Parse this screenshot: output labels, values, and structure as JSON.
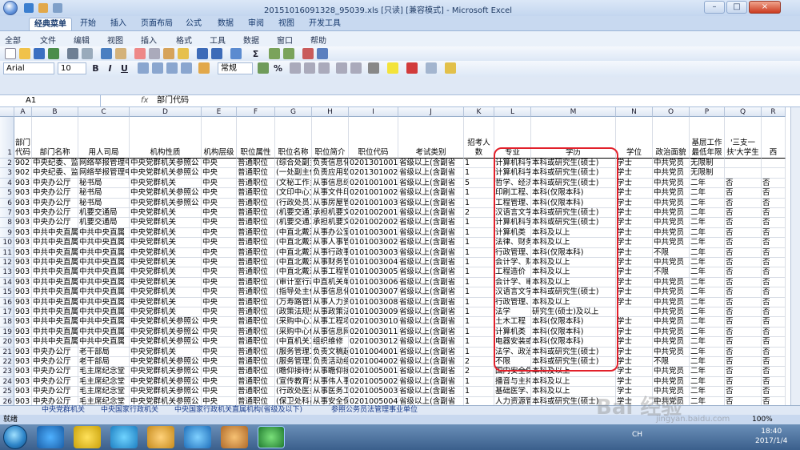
{
  "window": {
    "title": "20151016091328_95039.xls  [只读]  [兼容模式] - Microsoft Excel",
    "controls": [
      "–",
      "□",
      "×"
    ]
  },
  "ribbon_tabs": [
    "经典菜单",
    "开始",
    "插入",
    "页面布局",
    "公式",
    "数据",
    "审阅",
    "视图",
    "开发工具"
  ],
  "menus": [
    "全部",
    "文件",
    "编辑",
    "视图",
    "插入",
    "格式",
    "工具",
    "数据",
    "窗口",
    "帮助"
  ],
  "toolbar": {
    "font_name": "Arial",
    "font_size": "10",
    "number_format": "常规",
    "bold": "B",
    "italic": "I",
    "underline": "U",
    "sum": "Σ",
    "percent": "%"
  },
  "formula_bar": {
    "name_box": "A1",
    "fx": "fx",
    "value": "部门代码"
  },
  "columns": [
    "A",
    "B",
    "C",
    "D",
    "E",
    "F",
    "G",
    "H",
    "I",
    "J",
    "K",
    "L",
    "M",
    "N",
    "O",
    "P",
    "Q",
    "R"
  ],
  "header_row": {
    "row": "1",
    "cells": [
      "部门代码",
      "部门名称",
      "用人司局",
      "机构性质",
      "机构层级",
      "职位属性",
      "职位名称",
      "职位简介",
      "职位代码",
      "考试类别",
      "招考人数",
      "专业",
      "学历",
      "学位",
      "政治面貌",
      "基层工作最低年限",
      "'三支一扶'大学生",
      "西"
    ]
  },
  "rows": [
    {
      "n": "2",
      "c": [
        "902",
        "中央纪委、监",
        "网络举报管理中",
        "中央党群机关参照公",
        "中央",
        "普通职位",
        "(综合处副主",
        "负责信息化",
        "0201301001",
        "省级以上(含副省",
        "1",
        "计算机科学",
        "本科或研究生(硕士)",
        "学士",
        "中共党员",
        "无限制",
        "",
        ""
      ]
    },
    {
      "n": "3",
      "c": [
        "902",
        "中央纪委、监",
        "网络举报管理中",
        "中央党群机关参照公",
        "中央",
        "普通职位",
        "(一处副主任",
        "负责应用软",
        "0201301002",
        "省级以上(含副省",
        "1",
        "计算机科学",
        "本科或研究生(硕士)",
        "学士",
        "中共党员",
        "无限制",
        "",
        ""
      ]
    },
    {
      "n": "4",
      "c": [
        "903",
        "中央办公厅",
        "秘书局",
        "中央党群机关",
        "中央",
        "普通职位",
        "(文秘工作主",
        "从事信息综",
        "0201001001",
        "省级以上(含副省",
        "5",
        "哲学、经济",
        "本科或研究生(硕士)",
        "学士",
        "中共党员",
        "二年",
        "否",
        "否"
      ]
    },
    {
      "n": "5",
      "c": [
        "903",
        "中央办公厅",
        "秘书局",
        "中央党群机关参照公",
        "中央",
        "普通职位",
        "(文印中心文",
        "从事文件印",
        "0201001002",
        "省级以上(含副省",
        "1",
        "印刷工程、",
        "本科(仅限本科)",
        "学士",
        "中共党员",
        "二年",
        "否",
        "否"
      ]
    },
    {
      "n": "6",
      "c": [
        "903",
        "中央办公厅",
        "秘书局",
        "中央党群机关参照公",
        "中央",
        "普通职位",
        "(行政处员工",
        "从事房屋管",
        "0201001003",
        "省级以上(含副省",
        "1",
        "工程管理、",
        "本科(仅限本科)",
        "学士",
        "中共党员",
        "二年",
        "否",
        "否"
      ]
    },
    {
      "n": "7",
      "c": [
        "903",
        "中央办公厅",
        "机要交通局",
        "中央党群机关",
        "中央",
        "普通职位",
        "(机要交通工",
        "承担机要文",
        "0201002001",
        "省级以上(含副省",
        "2",
        "汉语言文学",
        "本科或研究生(硕士)",
        "学士",
        "中共党员",
        "二年",
        "否",
        "否"
      ]
    },
    {
      "n": "8",
      "c": [
        "903",
        "中央办公厅",
        "机要交通局",
        "中央党群机关",
        "中央",
        "普通职位",
        "(机要交通工",
        "承担机要文",
        "0201002002",
        "省级以上(含副省",
        "1",
        "计算机科学",
        "本科或研究生(硕士)",
        "学士",
        "中共党员",
        "二年",
        "否",
        "否"
      ]
    },
    {
      "n": "9",
      "c": [
        "903",
        "中共中央直属",
        "中共中央直属",
        "中央党群机关",
        "中央",
        "普通职位",
        "(中直北戴河",
        "从事办公室",
        "0101003001",
        "省级以上(含副省",
        "1",
        "计算机类",
        "本科及以上",
        "学士",
        "中共党员",
        "二年",
        "否",
        "否"
      ]
    },
    {
      "n": "10",
      "c": [
        "903",
        "中共中央直属",
        "中共中央直属",
        "中央党群机关",
        "中央",
        "普通职位",
        "(中直北戴河",
        "从事人事管",
        "0101003002",
        "省级以上(含副省",
        "1",
        "法律、财务",
        "本科及以上",
        "学士",
        "中共党员",
        "二年",
        "否",
        "否"
      ]
    },
    {
      "n": "11",
      "c": [
        "903",
        "中共中央直属",
        "中共中央直属",
        "中央党群机关",
        "中央",
        "普通职位",
        "(中直北戴河",
        "从事行政事",
        "0101003003",
        "省级以上(含副省",
        "1",
        "行政管理、",
        "本科(仅限本科)",
        "学士",
        "不限",
        "二年",
        "否",
        "否"
      ]
    },
    {
      "n": "12",
      "c": [
        "903",
        "中共中央直属",
        "中共中央直属",
        "中央党群机关",
        "中央",
        "普通职位",
        "(中直北戴河",
        "从事财务管",
        "0101003004",
        "省级以上(含副省",
        "1",
        "会计学、财",
        "本科及以上",
        "学士",
        "中共党员",
        "二年",
        "否",
        "否"
      ]
    },
    {
      "n": "13",
      "c": [
        "903",
        "中共中央直属",
        "中共中央直属",
        "中央党群机关",
        "中央",
        "普通职位",
        "(中直北戴河",
        "从事工程管",
        "0101003005",
        "省级以上(含副省",
        "1",
        "工程造价",
        "本科及以上",
        "学士",
        "不限",
        "二年",
        "否",
        "否"
      ]
    },
    {
      "n": "14",
      "c": [
        "903",
        "中共中央直属",
        "中共中央直属",
        "中央党群机关",
        "中央",
        "普通职位",
        "(审计室行政",
        "中直机关单",
        "0101003006",
        "省级以上(含副省",
        "1",
        "会计学、审",
        "本科及以上",
        "学士",
        "中共党员",
        "二年",
        "否",
        "否"
      ]
    },
    {
      "n": "15",
      "c": [
        "903",
        "中共中央直属",
        "中共中央直属",
        "中央党群机关",
        "中央",
        "普通职位",
        "(指导处主任",
        "从事信息化",
        "0101003007",
        "省级以上(含副省",
        "1",
        "汉语言文学",
        "本科或研究生(硕士)",
        "学士",
        "中共党员",
        "二年",
        "否",
        "否"
      ]
    },
    {
      "n": "16",
      "c": [
        "903",
        "中共中央直属",
        "中共中央直属",
        "中央党群机关",
        "中央",
        "普通职位",
        "(万寿路管理",
        "从事人力资",
        "0101003008",
        "省级以上(含副省",
        "1",
        "行政管理、",
        "本科及以上",
        "学士",
        "中共党员",
        "二年",
        "否",
        "否"
      ]
    },
    {
      "n": "17",
      "c": [
        "903",
        "中共中央直属",
        "中共中央直属",
        "中央党群机关",
        "中央",
        "普通职位",
        "(政策法规处",
        "从事政策法",
        "0101003009",
        "省级以上(含副省",
        "1",
        "法学",
        "研究生(硕士)及以上",
        "",
        "中共党员",
        "二年",
        "否",
        "否"
      ]
    },
    {
      "n": "18",
      "c": [
        "903",
        "中共中央直属",
        "中共中央直属",
        "中央党群机关参照公",
        "中央",
        "普通职位",
        "(采购中心工",
        "从事工程项",
        "0201003010",
        "省级以上(含副省",
        "1",
        "土木工程",
        "本科(仅限本科)",
        "学士",
        "中共党员",
        "二年",
        "否",
        "否"
      ]
    },
    {
      "n": "19",
      "c": [
        "903",
        "中共中央直属",
        "中共中央直属",
        "中央党群机关参照公",
        "中央",
        "普通职位",
        "(采购中心信",
        "从事信息网",
        "0201003011",
        "省级以上(含副省",
        "1",
        "计算机类",
        "本科(仅限本科)",
        "学士",
        "中共党员",
        "二年",
        "否",
        "否"
      ]
    },
    {
      "n": "20",
      "c": [
        "903",
        "中共中央直属",
        "中共中央直属",
        "中央党群机关参照公",
        "中央",
        "普通职位",
        "(中直机关工",
        "组织维修",
        "0201003012",
        "省级以上(含副省",
        "1",
        "电器安装或",
        "本科(仅限本科)",
        "学士",
        "中共党员",
        "二年",
        "否",
        "否"
      ]
    },
    {
      "n": "21",
      "c": [
        "903",
        "中央办公厅",
        "老干部局",
        "中央党群机关",
        "中央",
        "普通职位",
        "(服务管理工",
        "负责文稿起",
        "0101004001",
        "省级以上(含副省",
        "1",
        "法学、政治",
        "本科或研究生(硕士)",
        "学士",
        "中共党员",
        "二年",
        "否",
        "否"
      ]
    },
    {
      "n": "22",
      "c": [
        "903",
        "中央办公厅",
        "老干部局",
        "中央党群机关参照公",
        "中央",
        "普通职位",
        "(服务管理工",
        "负责活动组",
        "0201004002",
        "省级以上(含副省",
        "2",
        "不限",
        "本科或研究生(硕士)",
        "学士",
        "不限",
        "二年",
        "否",
        "否"
      ]
    },
    {
      "n": "23",
      "c": [
        "903",
        "中央办公厅",
        "毛主席纪念堂",
        "中央党群机关参照公",
        "中央",
        "普通职位",
        "(瞻仰接待处",
        "从事瞻仰接",
        "0201005001",
        "省级以上(含副省",
        "2",
        "国内安全保",
        "本科及以上",
        "学士",
        "中共党员",
        "二年",
        "否",
        "否"
      ]
    },
    {
      "n": "24",
      "c": [
        "903",
        "中央办公厅",
        "毛主席纪念堂",
        "中央党群机关参照公",
        "中央",
        "普通职位",
        "(宣传教育处",
        "从事伟人事",
        "0201005002",
        "省级以上(含副省",
        "1",
        "播音与主持",
        "本科及以上",
        "学士",
        "中共党员",
        "二年",
        "否",
        "否"
      ]
    },
    {
      "n": "25",
      "c": [
        "903",
        "中央办公厅",
        "毛主席纪念堂",
        "中央党群机关参照公",
        "中央",
        "普通职位",
        "(行政处医务",
        "从事医务工",
        "0201005003",
        "省级以上(含副省",
        "1",
        "基础医学、",
        "本科及以上",
        "学士",
        "中共党员",
        "二年",
        "否",
        "否"
      ]
    },
    {
      "n": "26",
      "c": [
        "903",
        "中央办公厅",
        "毛主席纪念堂",
        "中央党群机关参照公",
        "中央",
        "普通职位",
        "(保卫处科员",
        "从事安全保",
        "0201005004",
        "省级以上(含副省",
        "1",
        "人力资源管",
        "本科或研究生(硕士)",
        "学士",
        "中共党员",
        "二年",
        "否",
        "否"
      ]
    }
  ],
  "sheet_tabs": [
    "中央党群机关",
    "中央国家行政机关",
    "中央国家行政机关直属机构(省级及以下)",
    "参照公务员法管理事业单位"
  ],
  "status": "就绪",
  "zoom": "100%",
  "tray": {
    "lang": "CH",
    "time": "18:40",
    "date": "2017/1/4"
  },
  "watermark": "Bai 经验",
  "watermark_sub": "jingyan.baidu.com",
  "colors": {
    "highlight": "#e2202a",
    "ribbon": "#c8d9f0",
    "taskbar": "#3b5f8c"
  }
}
